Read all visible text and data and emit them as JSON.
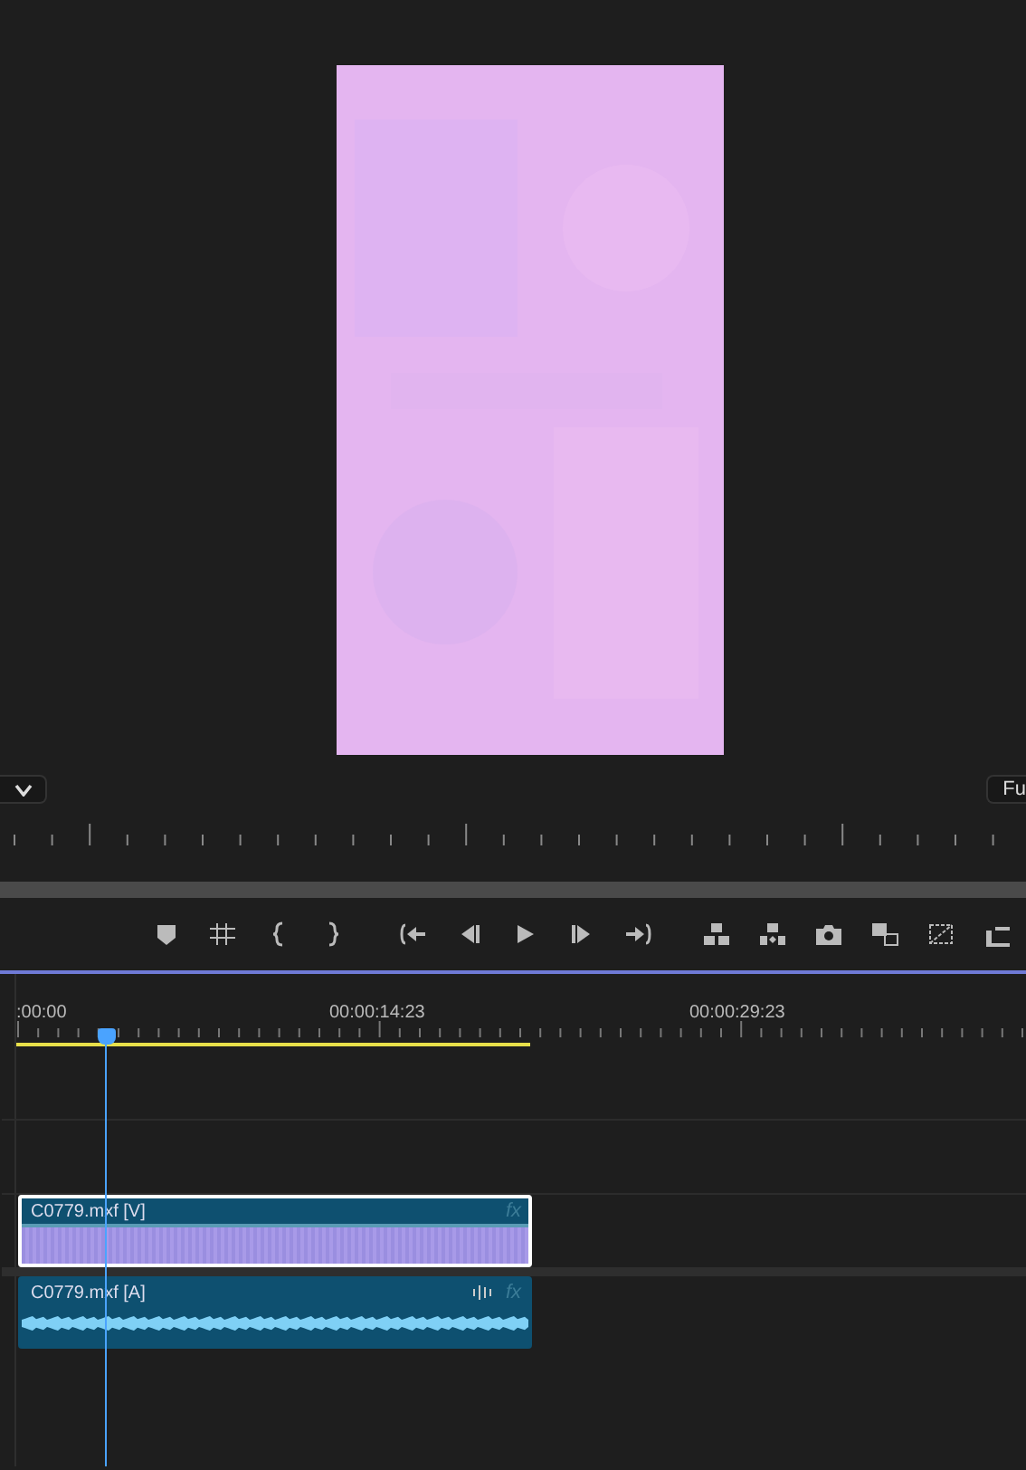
{
  "monitor": {
    "zoom_menu": {
      "expanded": false
    },
    "fit_label": "Fu"
  },
  "transport": {
    "buttons": [
      {
        "kind": "marker"
      },
      {
        "kind": "grid"
      },
      {
        "kind": "mark-in"
      },
      {
        "kind": "mark-out"
      },
      {
        "kind": "go-in"
      },
      {
        "kind": "step-back"
      },
      {
        "kind": "play"
      },
      {
        "kind": "step-forward"
      },
      {
        "kind": "go-out"
      },
      {
        "kind": "lift"
      },
      {
        "kind": "extract"
      },
      {
        "kind": "camera"
      },
      {
        "kind": "compare"
      },
      {
        "kind": "transform"
      },
      {
        "kind": "export"
      }
    ]
  },
  "timeline": {
    "timecodes": [
      ":00:00",
      "00:00:14:23",
      "00:00:29:23"
    ],
    "clips": [
      {
        "kind": "video",
        "name": "C0779.mxf [V]",
        "effect_badge": "fx",
        "selected": true
      },
      {
        "kind": "audio",
        "name": "C0779.mxf [A]",
        "effect_badge": "fx",
        "selected": false
      }
    ]
  }
}
